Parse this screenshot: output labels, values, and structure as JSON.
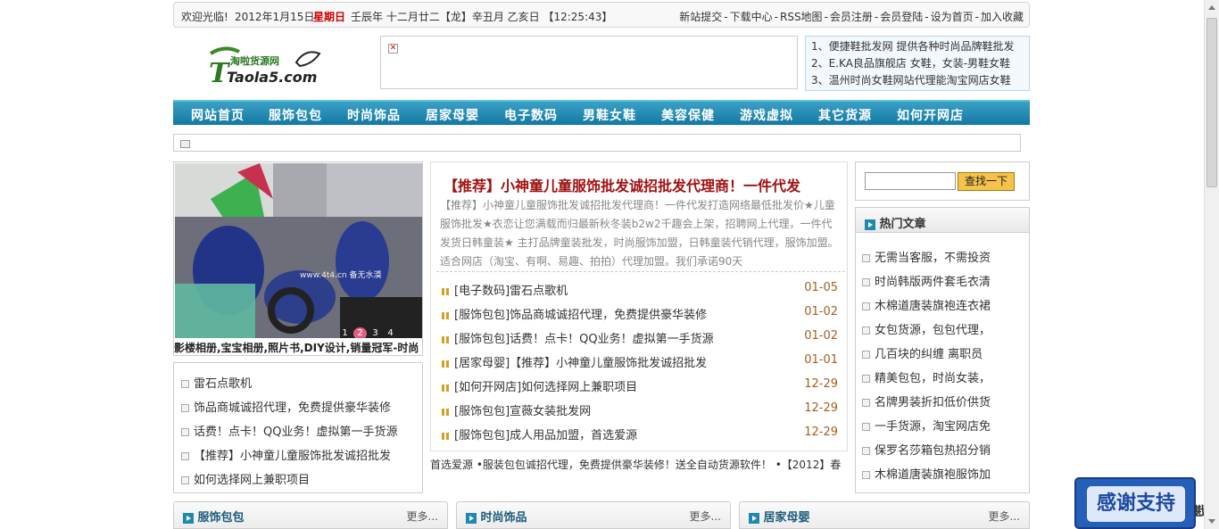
{
  "topbar": {
    "greeting": "欢迎光临!",
    "date": "2012年1月15日",
    "weekday": "星期日",
    "lunar": "壬辰年  十二月廿二【龙】辛丑月  乙亥日  【12:25:43】",
    "links": [
      "新站提交",
      "-",
      "下载中心",
      "-",
      "RSS地图",
      "-",
      "会员注册",
      "-",
      "会员登陆",
      "-",
      "设为首页",
      "-",
      "加入收藏"
    ]
  },
  "logo": {
    "cn": "淘啦货源网",
    "en": "Taola5.com"
  },
  "ad": {
    "broken_icon": "✕"
  },
  "toplist": [
    "1、便捷鞋批发网 提供各种时尚品牌鞋批发",
    "2、E.KA良品旗舰店 女鞋，女装-男鞋女鞋",
    "3、温州时尚女鞋网站代理能淘宝网店女鞋"
  ],
  "nav": [
    "网站首页",
    "服饰包包",
    "时尚饰品",
    "居家母婴",
    "电子数码",
    "男鞋女鞋",
    "美容保健",
    "游戏虚拟",
    "其它货源",
    "如何开网店"
  ],
  "slider": {
    "watermark": "www.4t4.cn 备无水漠",
    "pages": [
      "1",
      "2",
      "3",
      "4"
    ],
    "active_page": "2",
    "caption": "影楼相册,宝宝相册,照片书,DIY设计,销量冠军-时尚"
  },
  "left_list": [
    "雷石点歌机",
    "饰品商城诚招代理，免费提供豪华装修",
    "话费！点卡！QQ业务！虚拟第一手货源",
    "【推荐】小神童儿童服饰批发诚招批发",
    "如何选择网上兼职项目"
  ],
  "featured": {
    "headline": "【推荐】小神童儿童服饰批发诚招批发代理商！一件代发",
    "summary": "【推荐】小神童儿童服饰批发诚招批发代理商！一件代发打造网络最低批发价★儿童服饰批发★衣恋让您满载而归最新秋冬装b2w2千趣会上架，招聘网上代理，一件代发货日韩童装★ 主打品牌童装批发，时尚服饰加盟，日韩童装代销代理，服饰加盟。适合网店（淘宝、有啊、易趣、拍拍）代理加盟。我们承诺90天"
  },
  "center_list": [
    {
      "title": "[电子数码]雷石点歌机",
      "date": "01-05"
    },
    {
      "title": "[服饰包包]饰品商城诚招代理，免费提供豪华装修",
      "date": "01-02"
    },
    {
      "title": "[服饰包包]话费！点卡！QQ业务！虚拟第一手货源",
      "date": "01-02"
    },
    {
      "title": "[居家母婴]【推荐】小神童儿童服饰批发诚招批发",
      "date": "01-01"
    },
    {
      "title": "[如何开网店]如何选择网上兼职项目",
      "date": "12-29"
    },
    {
      "title": "[服饰包包]宣薇女装批发网",
      "date": "12-29"
    },
    {
      "title": "[服饰包包]成人用品加盟，首选爱源",
      "date": "12-29"
    }
  ],
  "marquee": "首选爱源  •服装包包诚招代理，免费提供豪华装修！送全自动货源软件！  •【2012】春",
  "search": {
    "button": "查找一下",
    "value": ""
  },
  "hot": {
    "title": "热门文章",
    "items": [
      "无需当客服，不需投资",
      "时尚韩版两件套毛衣清",
      "木棉道唐装旗袍连衣裙",
      "女包货源，包包代理，",
      "几百块的纠缠 离职员",
      "精美包包，时尚女装，",
      "名牌男装折扣低价供货",
      "一手货源，淘宝网店免",
      "保罗名莎箱包热招分销",
      "木棉道唐装旗袍服饰加"
    ]
  },
  "sections": [
    {
      "title": "服饰包包",
      "more": "更多..."
    },
    {
      "title": "时尚饰品",
      "more": "更多..."
    },
    {
      "title": "居家母婴",
      "more": "更多..."
    }
  ],
  "thanks": "感谢支持",
  "edge_text": "戡",
  "colors": {
    "nav": "#1479a3",
    "headline": "#a01010",
    "date": "#a06020",
    "weekday": "#cc0000"
  }
}
